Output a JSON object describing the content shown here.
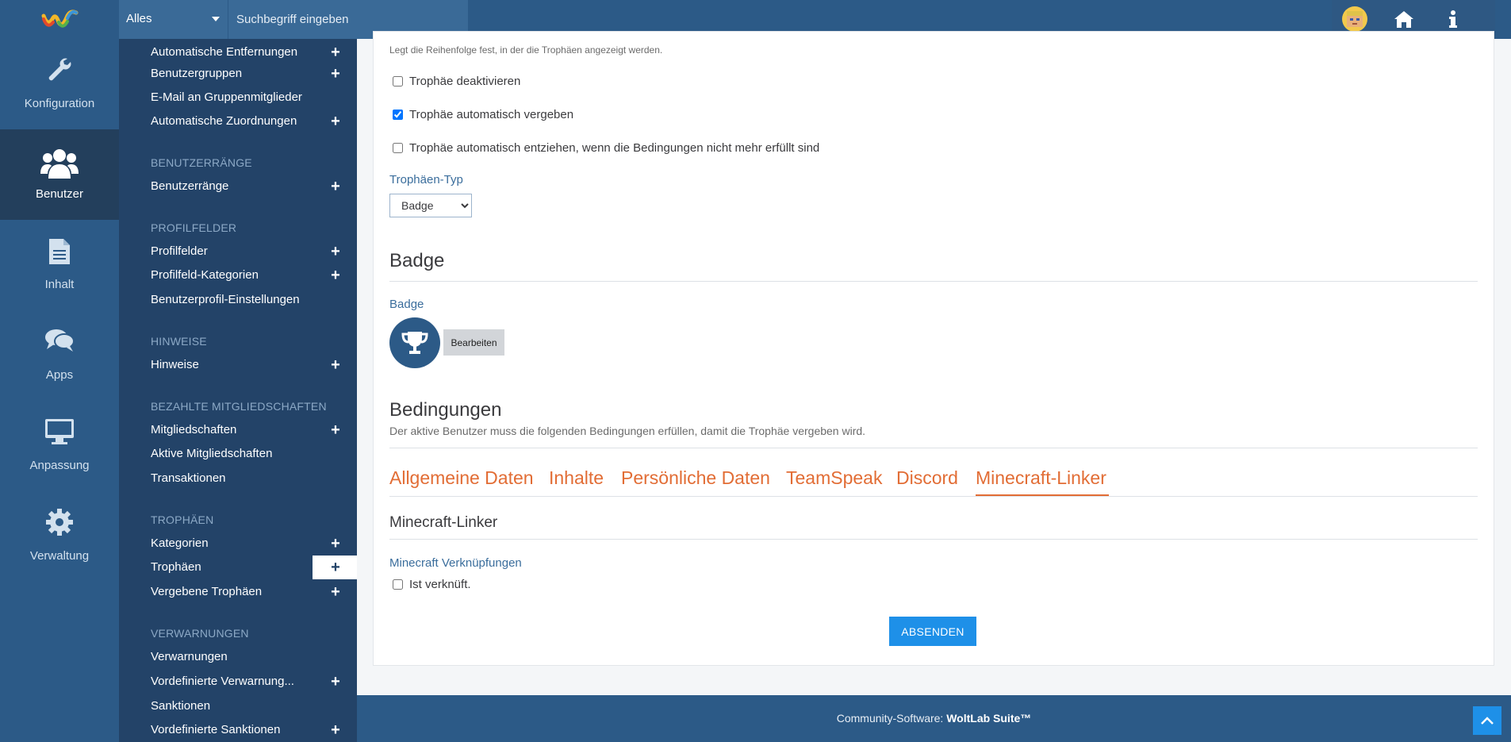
{
  "topbar": {
    "search_scope": "Alles",
    "search_placeholder": "Suchbegriff eingeben"
  },
  "rail": {
    "items": [
      {
        "label": "Konfiguration",
        "icon": "wrench-icon"
      },
      {
        "label": "Benutzer",
        "icon": "users-icon",
        "active": true
      },
      {
        "label": "Inhalt",
        "icon": "document-icon"
      },
      {
        "label": "Apps",
        "icon": "comments-icon"
      },
      {
        "label": "Anpassung",
        "icon": "desktop-icon"
      },
      {
        "label": "Verwaltung",
        "icon": "gear-icon"
      }
    ]
  },
  "subnav": {
    "items": [
      "Automatische Entfernungen",
      "Benutzergruppen",
      "E-Mail an Gruppenmitglieder",
      "Automatische Zuordnungen",
      "Benutzerränge",
      "Profilfelder",
      "Profilfeld-Kategorien",
      "Benutzerprofil-Einstellungen",
      "Hinweise",
      "Mitgliedschaften",
      "Aktive Mitgliedschaften",
      "Transaktionen",
      "Kategorien",
      "Trophäen",
      "Vergebene Trophäen",
      "Verwarnungen",
      "Vordefinierte Verwarnung...",
      "Sanktionen",
      "Vordefinierte Sanktionen"
    ],
    "headings": [
      "BENUTZERRÄNGE",
      "PROFILFELDER",
      "HINWEISE",
      "BEZAHLTE MITGLIEDSCHAFTEN",
      "TROPHÄEN",
      "VERWARNUNGEN"
    ]
  },
  "form": {
    "order_hint": "Legt die Reihenfolge fest, in der die Trophäen angezeigt werden.",
    "disable_label": "Trophäe deaktivieren",
    "auto_award_label": "Trophäe automatisch vergeben",
    "auto_revoke_label": "Trophäe automatisch entziehen, wenn die Bedingungen nicht mehr erfüllt sind",
    "type_label": "Trophäen-Typ",
    "type_selected": "Badge",
    "badge_section_title": "Badge",
    "badge_label": "Badge",
    "edit_button": "Bearbeiten",
    "conditions_title": "Bedingungen",
    "conditions_desc": "Der aktive Benutzer muss die folgenden Bedingungen erfüllen, damit die Trophäe vergeben wird.",
    "tabs": [
      "Allgemeine Daten",
      "Inhalte",
      "Persönliche Daten",
      "TeamSpeak",
      "Discord",
      "Minecraft-Linker"
    ],
    "active_tab": "Minecraft-Linker",
    "minecraft_title": "Minecraft-Linker",
    "minecraft_field_label": "Minecraft Verknüpfungen",
    "linked_label": "Ist verknüft.",
    "submit_button": "ABSENDEN"
  },
  "footer": {
    "prefix": "Community-Software: ",
    "brand": "WoltLab Suite™"
  },
  "colors": {
    "header": "#2c5a87",
    "subnav": "#234368",
    "tab_accent": "#e26d35",
    "submit": "#1e90e8"
  }
}
